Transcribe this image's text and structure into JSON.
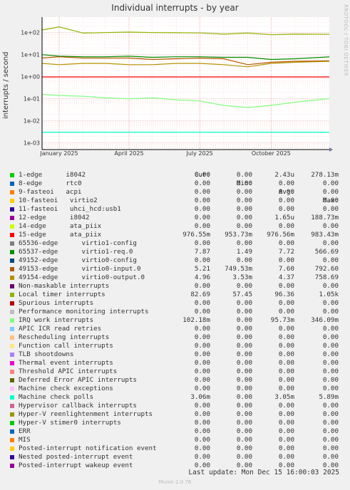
{
  "title": "Individual interrupts - by year",
  "watermark": "RRDTOOL / TOBI OETIKER",
  "ylabel": "interrupts / second",
  "headers": {
    "cur": "Cur:",
    "min": "Min:",
    "avg": "Avg:",
    "max": "Max:"
  },
  "legend": [
    {
      "name": "1-edge      i8042",
      "color": "#00cc00",
      "cur": "0.00",
      "min": "0.00",
      "avg": "2.43u",
      "max": "278.13m"
    },
    {
      "name": "8-edge      rtc0",
      "color": "#0066b3",
      "cur": "0.00",
      "min": "0.00",
      "avg": "0.00",
      "max": "0.00"
    },
    {
      "name": "9-fasteoi   acpi",
      "color": "#ff8000",
      "cur": "0.00",
      "min": "0.00",
      "avg": "0.00",
      "max": "0.00"
    },
    {
      "name": "10-fasteoi   virtio2",
      "color": "#ffcc00",
      "cur": "0.00",
      "min": "0.00",
      "avg": "0.00",
      "max": "0.00"
    },
    {
      "name": "11-fasteoi   uhci_hcd:usb1",
      "color": "#330099",
      "cur": "0.00",
      "min": "0.00",
      "avg": "0.00",
      "max": "0.00"
    },
    {
      "name": "12-edge      i8042",
      "color": "#990099",
      "cur": "0.00",
      "min": "0.00",
      "avg": "1.65u",
      "max": "188.73m"
    },
    {
      "name": "14-edge      ata_piix",
      "color": "#ccff00",
      "cur": "0.00",
      "min": "0.00",
      "avg": "0.00",
      "max": "0.00"
    },
    {
      "name": "15-edge      ata_piix",
      "color": "#ff0000",
      "cur": "976.55m",
      "min": "953.73m",
      "avg": "976.56m",
      "max": "983.43m"
    },
    {
      "name": "65536-edge      virtio1-config",
      "color": "#808080",
      "cur": "0.00",
      "min": "0.00",
      "avg": "0.00",
      "max": "0.00"
    },
    {
      "name": "65537-edge      virtio1-req.0",
      "color": "#008f00",
      "cur": "7.87",
      "min": "1.49",
      "avg": "7.72",
      "max": "566.69"
    },
    {
      "name": "49152-edge      virtio0-config",
      "color": "#00487d",
      "cur": "0.00",
      "min": "0.00",
      "avg": "0.00",
      "max": "0.00"
    },
    {
      "name": "49153-edge      virtio0-input.0",
      "color": "#b35a00",
      "cur": "5.21",
      "min": "749.53m",
      "avg": "7.60",
      "max": "792.60"
    },
    {
      "name": "49154-edge      virtio0-output.0",
      "color": "#b38f00",
      "cur": "4.96",
      "min": "3.53m",
      "avg": "4.37",
      "max": "758.69"
    },
    {
      "name": "Non-maskable interrupts",
      "color": "#6b006b",
      "cur": "0.00",
      "min": "0.00",
      "avg": "0.00",
      "max": "0.00"
    },
    {
      "name": "Local timer interrupts",
      "color": "#8fb300",
      "cur": "82.69",
      "min": "57.45",
      "avg": "96.36",
      "max": "1.05k"
    },
    {
      "name": "Spurious interrupts",
      "color": "#b30000",
      "cur": "0.00",
      "min": "0.00",
      "avg": "0.00",
      "max": "0.00"
    },
    {
      "name": "Performance monitoring interrupts",
      "color": "#bebebe",
      "cur": "0.00",
      "min": "0.00",
      "avg": "0.00",
      "max": "0.00"
    },
    {
      "name": "IRQ work interrupts",
      "color": "#80ff80",
      "cur": "102.18m",
      "min": "0.00",
      "avg": "95.73m",
      "max": "346.09m"
    },
    {
      "name": "APIC ICR read retries",
      "color": "#80c9ff",
      "cur": "0.00",
      "min": "0.00",
      "avg": "0.00",
      "max": "0.00"
    },
    {
      "name": "Rescheduling interrupts",
      "color": "#ffc080",
      "cur": "0.00",
      "min": "0.00",
      "avg": "0.00",
      "max": "0.00"
    },
    {
      "name": "Function call interrupts",
      "color": "#ffe680",
      "cur": "0.00",
      "min": "0.00",
      "avg": "0.00",
      "max": "0.00"
    },
    {
      "name": "TLB shootdowns",
      "color": "#aa80ff",
      "cur": "0.00",
      "min": "0.00",
      "avg": "0.00",
      "max": "0.00"
    },
    {
      "name": "Thermal event interrupts",
      "color": "#ee00cc",
      "cur": "0.00",
      "min": "0.00",
      "avg": "0.00",
      "max": "0.00"
    },
    {
      "name": "Threshold APIC interrupts",
      "color": "#ff8080",
      "cur": "0.00",
      "min": "0.00",
      "avg": "0.00",
      "max": "0.00"
    },
    {
      "name": "Deferred Error APIC interrupts",
      "color": "#666600",
      "cur": "0.00",
      "min": "0.00",
      "avg": "0.00",
      "max": "0.00"
    },
    {
      "name": "Machine check exceptions",
      "color": "#ffbfff",
      "cur": "0.00",
      "min": "0.00",
      "avg": "0.00",
      "max": "0.00"
    },
    {
      "name": "Machine check polls",
      "color": "#00ffcc",
      "cur": "3.06m",
      "min": "0.00",
      "avg": "3.05m",
      "max": "5.89m"
    },
    {
      "name": "Hypervisor callback interrupts",
      "color": "#cc6699",
      "cur": "0.00",
      "min": "0.00",
      "avg": "0.00",
      "max": "0.00"
    },
    {
      "name": "Hyper-V reenlightenment interrupts",
      "color": "#999900",
      "cur": "0.00",
      "min": "0.00",
      "avg": "0.00",
      "max": "0.00"
    },
    {
      "name": "Hyper-V stimer0 interrupts",
      "color": "#00cc00",
      "cur": "0.00",
      "min": "0.00",
      "avg": "0.00",
      "max": "0.00"
    },
    {
      "name": "ERR",
      "color": "#0066b3",
      "cur": "0.00",
      "min": "0.00",
      "avg": "0.00",
      "max": "0.00"
    },
    {
      "name": "MIS",
      "color": "#ff8000",
      "cur": "0.00",
      "min": "0.00",
      "avg": "0.00",
      "max": "0.00"
    },
    {
      "name": "Posted-interrupt notification event",
      "color": "#ffcc00",
      "cur": "0.00",
      "min": "0.00",
      "avg": "0.00",
      "max": "0.00"
    },
    {
      "name": "Nested posted-interrupt event",
      "color": "#330099",
      "cur": "0.00",
      "min": "0.00",
      "avg": "0.00",
      "max": "0.00"
    },
    {
      "name": "Posted-interrupt wakeup event",
      "color": "#990099",
      "cur": "0.00",
      "min": "0.00",
      "avg": "0.00",
      "max": "0.00"
    }
  ],
  "last_update": "Last update: Mon Dec 15 16:00:03 2025",
  "version": "Munin 2.0.76",
  "chart_data": {
    "type": "line",
    "title": "Individual interrupts - by year",
    "ylabel": "interrupts / second",
    "yscale": "log",
    "ylim": [
      0.0005,
      500
    ],
    "yticks": [
      0.001,
      0.01,
      0.1,
      1,
      10,
      100
    ],
    "ytick_labels": [
      "1e-03",
      "1e-02",
      "1e-01",
      "1e+00",
      "1e+01",
      "1e+02"
    ],
    "xlim": [
      "2024-12-10",
      "2025-12-15"
    ],
    "xticks": [
      "2025-01-01",
      "2025-04-01",
      "2025-07-01",
      "2025-10-01"
    ],
    "xtick_labels": [
      "January 2025",
      "April 2025",
      "July 2025",
      "October 2025"
    ],
    "grid": true,
    "series": [
      {
        "name": "Local timer interrupts",
        "color": "#8fb300",
        "x": [
          "2024-12-10",
          "2025-01-01",
          "2025-02-01",
          "2025-03-01",
          "2025-04-01",
          "2025-05-01",
          "2025-06-01",
          "2025-07-01",
          "2025-08-01",
          "2025-09-01",
          "2025-10-01",
          "2025-11-01",
          "2025-12-15"
        ],
        "y": [
          130,
          180,
          95,
          100,
          105,
          100,
          98,
          96,
          85,
          95,
          80,
          85,
          82.69
        ]
      },
      {
        "name": "65537-edge      virtio1-req.0",
        "color": "#008f00",
        "x": [
          "2024-12-10",
          "2025-01-01",
          "2025-02-01",
          "2025-03-01",
          "2025-04-01",
          "2025-05-01",
          "2025-06-01",
          "2025-07-01",
          "2025-08-01",
          "2025-09-01",
          "2025-10-01",
          "2025-11-01",
          "2025-12-15"
        ],
        "y": [
          10,
          8.5,
          8.0,
          8.0,
          8.5,
          7.5,
          8.0,
          8.0,
          7.5,
          7.5,
          6.0,
          6.5,
          7.87
        ]
      },
      {
        "name": "49153-edge      virtio0-input.0",
        "color": "#b35a00",
        "x": [
          "2024-12-10",
          "2025-01-01",
          "2025-02-01",
          "2025-03-01",
          "2025-04-01",
          "2025-05-01",
          "2025-06-01",
          "2025-07-01",
          "2025-08-01",
          "2025-09-01",
          "2025-10-01",
          "2025-11-01",
          "2025-12-15"
        ],
        "y": [
          7,
          8,
          7,
          7,
          7,
          6,
          6.5,
          7,
          6.5,
          3.5,
          4.5,
          5,
          5.21
        ]
      },
      {
        "name": "49154-edge      virtio0-output.0",
        "color": "#b38f00",
        "x": [
          "2024-12-10",
          "2025-01-01",
          "2025-02-01",
          "2025-03-01",
          "2025-04-01",
          "2025-05-01",
          "2025-06-01",
          "2025-07-01",
          "2025-08-01",
          "2025-09-01",
          "2025-10-01",
          "2025-11-01",
          "2025-12-15"
        ],
        "y": [
          4,
          3.5,
          4,
          4,
          3.5,
          3.5,
          4,
          4,
          3.5,
          2.8,
          4,
          4.5,
          4.96
        ]
      },
      {
        "name": "15-edge      ata_piix",
        "color": "#ff0000",
        "x": [
          "2024-12-10",
          "2025-12-15"
        ],
        "y": [
          0.976,
          0.976
        ]
      },
      {
        "name": "IRQ work interrupts",
        "color": "#80ff80",
        "x": [
          "2024-12-10",
          "2025-01-01",
          "2025-02-01",
          "2025-03-01",
          "2025-04-01",
          "2025-05-01",
          "2025-06-01",
          "2025-07-01",
          "2025-08-01",
          "2025-09-01",
          "2025-10-01",
          "2025-11-01",
          "2025-12-15"
        ],
        "y": [
          0.16,
          0.14,
          0.13,
          0.11,
          0.1,
          0.11,
          0.09,
          0.08,
          0.05,
          0.04,
          0.05,
          0.07,
          0.102
        ]
      },
      {
        "name": "Machine check polls",
        "color": "#00ffcc",
        "x": [
          "2024-12-10",
          "2025-12-15"
        ],
        "y": [
          0.00306,
          0.00306
        ]
      }
    ]
  }
}
